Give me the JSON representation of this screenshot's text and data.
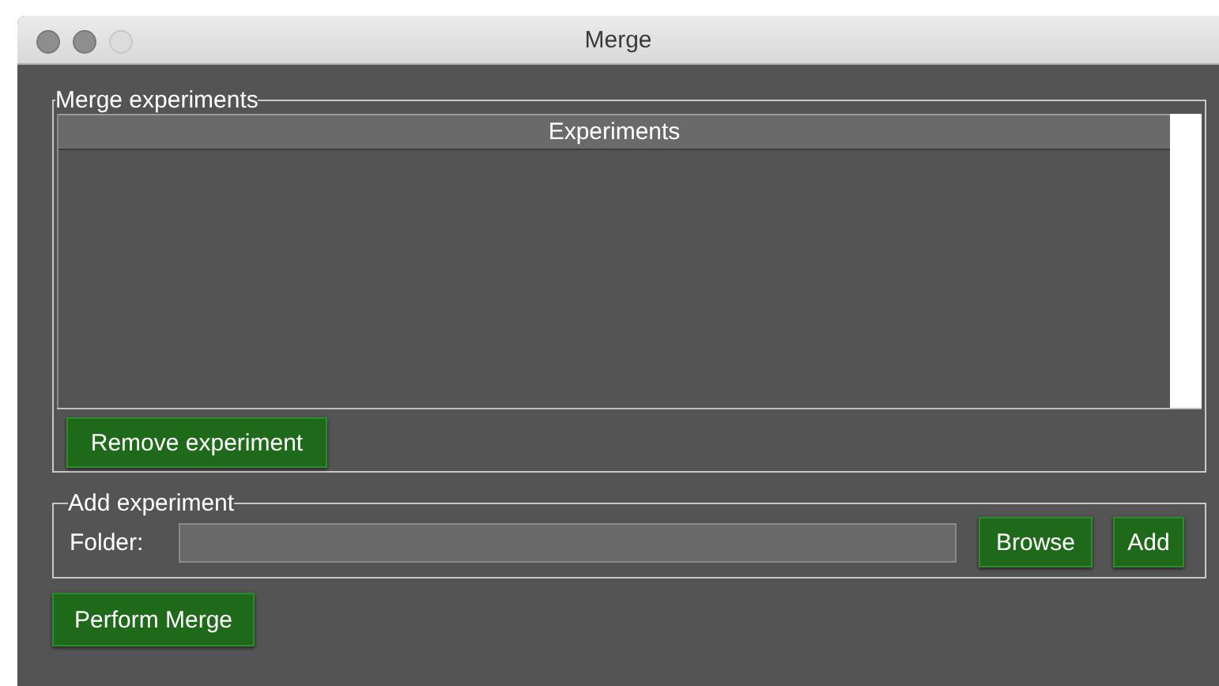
{
  "window": {
    "title": "Merge"
  },
  "merge_group": {
    "title": "Merge experiments",
    "table": {
      "columns": [
        "Experiments"
      ]
    },
    "remove_button": "Remove experiment"
  },
  "add_group": {
    "title": "Add experiment",
    "folder_label": "Folder:",
    "browse_button": "Browse",
    "add_button": "Add"
  },
  "perform_button": "Perform Merge"
}
